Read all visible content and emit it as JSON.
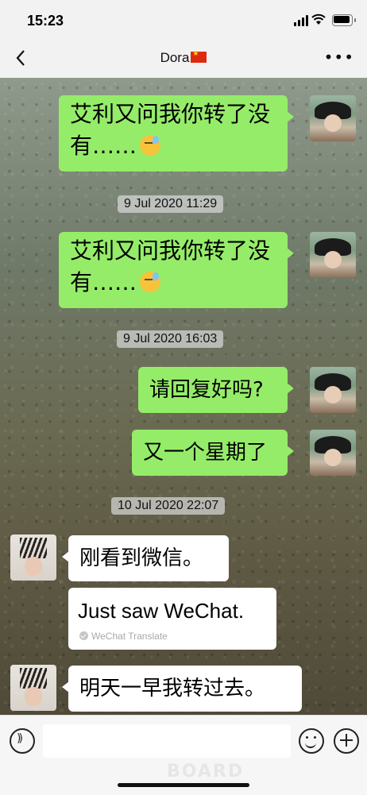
{
  "status_bar": {
    "time": "15:23"
  },
  "nav": {
    "title": "Dora",
    "flag_icon": "china-flag-icon"
  },
  "messages": [
    {
      "text": "艾利又问我你转了没有……",
      "side": "out"
    },
    {
      "timestamp": "9 Jul 2020 11:29"
    },
    {
      "text": "艾利又问我你转了没有……",
      "side": "out"
    },
    {
      "timestamp": "9 Jul 2020 16:03"
    },
    {
      "text": "请回复好吗?",
      "side": "out"
    },
    {
      "text": "又一个星期了",
      "side": "out"
    },
    {
      "timestamp": "10 Jul 2020 22:07"
    },
    {
      "text": "刚看到微信。",
      "side": "in",
      "translation": "Just saw WeChat.",
      "translation_label": "WeChat Translate"
    },
    {
      "text": "明天一早我转过去。",
      "side": "in"
    }
  ],
  "msg1": {
    "line1": "艾利又问我你转了没",
    "line2": "有……"
  },
  "ts1": "9 Jul 2020 11:29",
  "msg2": {
    "line1": "艾利又问我你转了没",
    "line2": "有……"
  },
  "ts2": "9 Jul 2020 16:03",
  "msg3": "请回复好吗?",
  "msg4": "又一个星期了",
  "ts3": "10 Jul 2020 22:07",
  "msg5": "刚看到微信。",
  "translation": {
    "text": "Just saw WeChat.",
    "label": "WeChat Translate"
  },
  "msg6": "明天一早我转过去。",
  "watermark": "BOARD",
  "colors": {
    "outgoing_bubble": "#95ec69",
    "incoming_bubble": "#ffffff",
    "nav_bg": "#f2f2f2"
  }
}
